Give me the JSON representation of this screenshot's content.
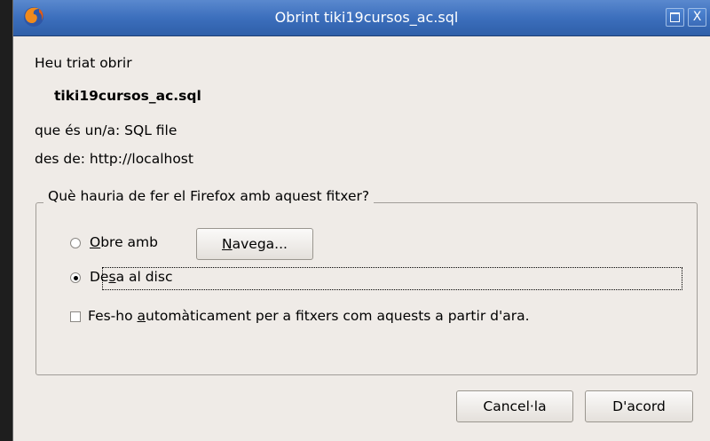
{
  "window": {
    "title": "Obrint tiki19cursos_ac.sql",
    "icon": "firefox-icon",
    "maximize_icon": "maximize-icon",
    "close_label": "X"
  },
  "info": {
    "intro": "Heu triat obrir",
    "filename": "tiki19cursos_ac.sql",
    "type_line": "que és un/a: SQL file",
    "source_line": "des de: http://localhost"
  },
  "action_group": {
    "legend": "Què hauria de fer el Firefox amb aquest fitxer?",
    "open_with": {
      "mnemonic": "O",
      "rest": "bre amb",
      "selected": false
    },
    "browse_button": {
      "mnemonic": "N",
      "rest": "avega..."
    },
    "save_to_disk": {
      "pre": "De",
      "mnemonic": "s",
      "post": "a al disc",
      "selected": true
    },
    "auto_checkbox": {
      "pre": "Fes-ho ",
      "mnemonic": "a",
      "post": "utomàticament per a fitxers com aquests a partir d'ara.",
      "checked": false
    }
  },
  "buttons": {
    "cancel": "Cancel·la",
    "ok": "D'acord"
  }
}
